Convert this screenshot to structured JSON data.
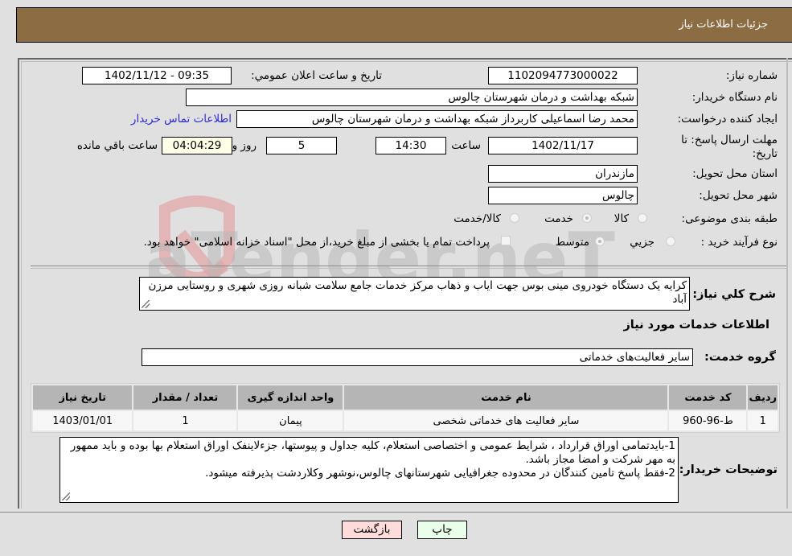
{
  "header": {
    "title": "جزئیات اطلاعات نیاز"
  },
  "fields": {
    "need_number": {
      "label": "شماره نیاز:",
      "value": "1102094773000022"
    },
    "announce_datetime": {
      "label": "تاریخ و ساعت اعلان عمومي:",
      "value": "1402/11/12 - 09:35"
    },
    "buyer_org": {
      "label": "نام دستگاه خريدار:",
      "value": "شبکه بهداشت و درمان شهرستان چالوس"
    },
    "requester": {
      "label": "ایجاد کننده درخواست:",
      "value": "محمد رضا اسماعیلی  کاربرداز شبکه بهداشت و درمان شهرستان چالوس"
    },
    "buyer_contact_link": "اطلاعات تماس خريدار",
    "deadline": {
      "label_line1": "مهلت ارسال پاسخ: تا",
      "label_line2": "تاریخ:",
      "date": "1402/11/17",
      "time_label": "ساعت",
      "time": "14:30",
      "days": "5",
      "days_label": "روز و",
      "remaining": "04:04:29",
      "remaining_label": "ساعت باقي مانده"
    },
    "province": {
      "label": "استان محل تحویل:",
      "value": "مازندران"
    },
    "city": {
      "label": "شهر محل تحویل:",
      "value": "چالوس"
    },
    "category": {
      "label": "طبقه بندی موضوعی:",
      "options": [
        "کالا",
        "خدمت",
        "کالا/خدمت"
      ],
      "selected": "خدمت"
    },
    "purchase_type": {
      "label": "نوع فرآیند خرید :",
      "options": [
        "جزيي",
        "متوسط"
      ],
      "selected": "متوسط",
      "treasury_note": "پرداخت تمام یا بخشی از مبلغ خرید،از محل \"اسناد خزانه اسلامی\" خواهد بود."
    }
  },
  "description": {
    "label": "شرح کلي نياز:",
    "value": "کرایه یک دستگاه خودروی مینی بوس جهت ایاب و ذهاب مرکز خدمات جامع سلامت شبانه  روزی شهری و روستایی مرزن آباد"
  },
  "services_section": {
    "title": "اطلاعات خدمات مورد نیاز",
    "group_label": "گروه خدمت:",
    "group_value": "سایر فعالیت‌های خدماتی",
    "table": {
      "headers": [
        "ردیف",
        "کد خدمت",
        "نام خدمت",
        "واحد اندازه گیری",
        "تعداد / مقدار",
        "تاریخ نیاز"
      ],
      "rows": [
        [
          "1",
          "ط-96-960",
          "سایر فعالیت های خدماتی شخصی",
          "پیمان",
          "1",
          "1403/01/01"
        ]
      ]
    }
  },
  "buyer_notes": {
    "label": "توضیحات خریدار:",
    "lines": [
      "1-بایدتمامی اوراق قرارداد ، شرایط عمومی و اختصاصی استعلام، کلیه جداول و پیوستها، جزءلاینفک اوراق استعلام بها بوده و باید ممهور به مهر شرکت و امضا مجاز باشد.",
      "2-فقط پاسخ تامین کنندگان در محدوده جغرافیایی شهرستانهای چالوس،نوشهر وکلاردشت پذیرفته میشود."
    ]
  },
  "buttons": {
    "print": "چاپ",
    "back": "بازگشت"
  },
  "colors": {
    "header_bg": "#8c6d43",
    "print_bg": "#eaffea",
    "back_bg": "#ffdcdc",
    "link": "#2b2bd1"
  },
  "watermark": {
    "text": "AriaTender.neT"
  }
}
